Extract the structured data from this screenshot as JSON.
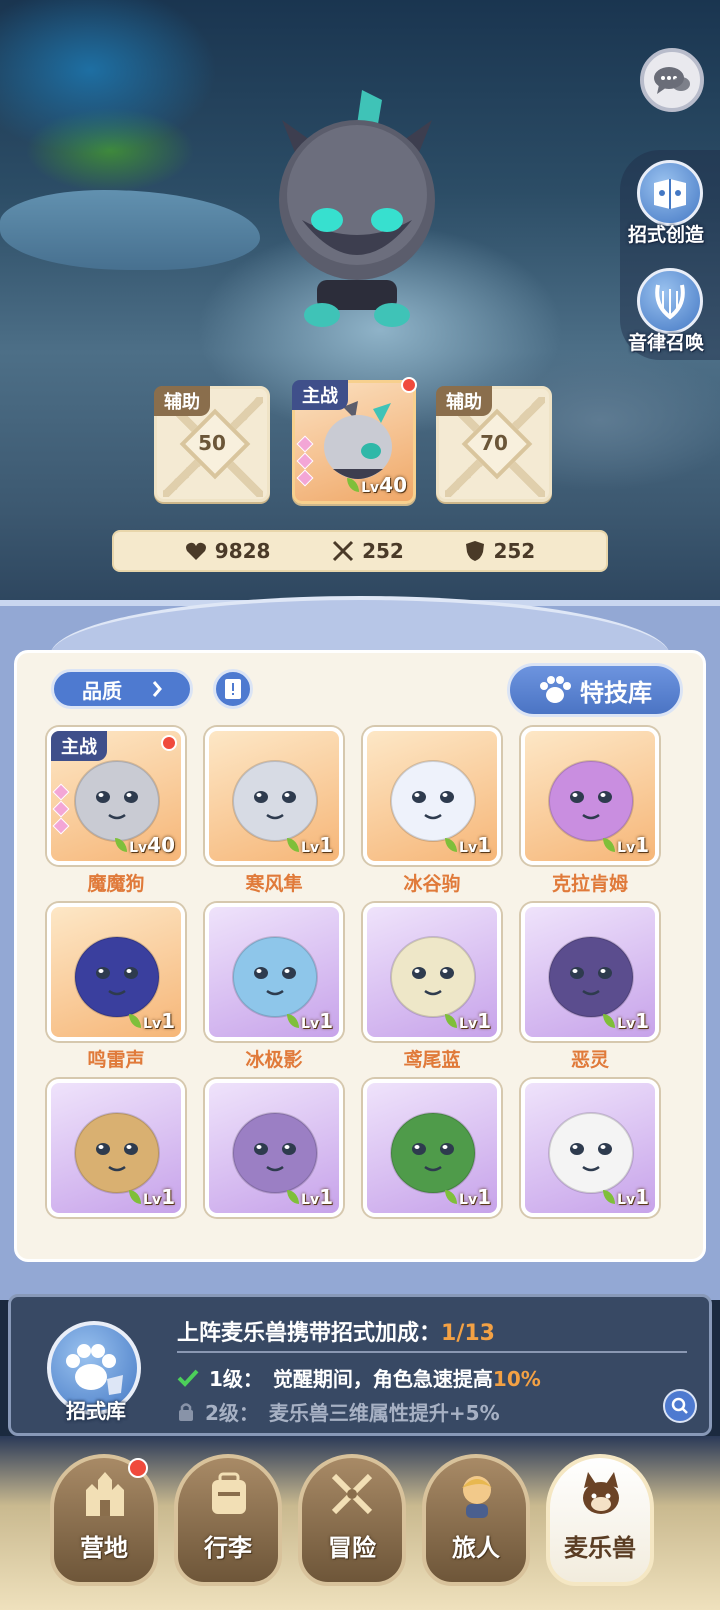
{
  "top_right": {
    "chat_icon": "chat-bubbles-icon",
    "buttons": [
      {
        "label": "招式创造",
        "icon": "skill-create-icon"
      },
      {
        "label": "音律召唤",
        "icon": "lyre-icon"
      }
    ]
  },
  "team": {
    "left_slot": {
      "tag": "辅助",
      "unlock_level": "50"
    },
    "main_slot": {
      "tag": "主战",
      "level": "40",
      "level_label": "Lv"
    },
    "right_slot": {
      "tag": "辅助",
      "unlock_level": "70"
    }
  },
  "stats": {
    "hp": "9828",
    "attack": "252",
    "defense": "252"
  },
  "toolbar": {
    "quality_label": "品质",
    "skill_lib_label": "特技库"
  },
  "pets": [
    {
      "name": "魔魔狗",
      "level": "40",
      "rarity": "orange",
      "tag": "主战",
      "color": "#c9cbd3"
    },
    {
      "name": "寒风隼",
      "level": "1",
      "rarity": "orange",
      "color": "#d7dbe4"
    },
    {
      "name": "冰谷驹",
      "level": "1",
      "rarity": "orange",
      "color": "#eef2fb"
    },
    {
      "name": "克拉肯姆",
      "level": "1",
      "rarity": "orange",
      "color": "#c98ee0"
    },
    {
      "name": "鸣雷声",
      "level": "1",
      "rarity": "orange",
      "color": "#3a3f9e"
    },
    {
      "name": "冰极影",
      "level": "1",
      "rarity": "purple",
      "color": "#8ec6ea"
    },
    {
      "name": "鸢尾蓝",
      "level": "1",
      "rarity": "purple",
      "color": "#eee7c8"
    },
    {
      "name": "恶灵",
      "level": "1",
      "rarity": "purple",
      "color": "#5b4d8e"
    },
    {
      "name": "",
      "level": "1",
      "rarity": "purple",
      "color": "#d9b071"
    },
    {
      "name": "",
      "level": "1",
      "rarity": "purple",
      "color": "#9b7fc4"
    },
    {
      "name": "",
      "level": "1",
      "rarity": "purple",
      "color": "#4f9b4a"
    },
    {
      "name": "",
      "level": "1",
      "rarity": "purple",
      "color": "#f4f4f4"
    }
  ],
  "bonus": {
    "icon_label": "招式库",
    "title": "上阵麦乐兽携带招式加成：",
    "progress": "1/13",
    "line1_level": "1级：",
    "line1_text": "觉醒期间，角色急速提高",
    "line1_value": "10%",
    "line2_level": "2级：",
    "line2_text": "麦乐兽三维属性提升+5%"
  },
  "nav": [
    {
      "label": "营地",
      "icon": "castle-icon",
      "badge": true
    },
    {
      "label": "行李",
      "icon": "backpack-icon",
      "badge": false
    },
    {
      "label": "冒险",
      "icon": "crossed-swords-icon",
      "badge": false
    },
    {
      "label": "旅人",
      "icon": "traveler-icon",
      "badge": false
    },
    {
      "label": "麦乐兽",
      "icon": "pet-face-icon",
      "badge": false,
      "active": true
    }
  ],
  "colors": {
    "accent_orange": "#f3a144",
    "pet_name": "#e07a3a",
    "primary_blue": "#4e7ad0",
    "badge_red": "#f04a3c"
  }
}
